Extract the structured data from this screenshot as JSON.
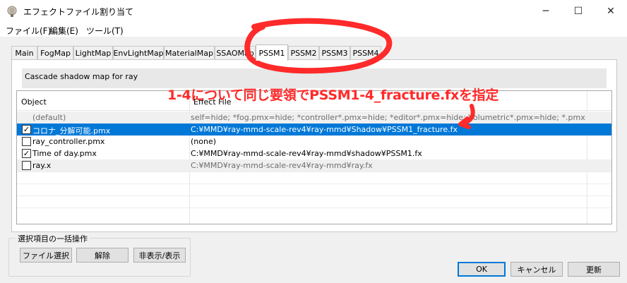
{
  "window": {
    "title": "エフェクトファイル割り当て",
    "minimize_glyph": "─",
    "maximize_glyph": "☐",
    "close_glyph": "✕"
  },
  "menu": [
    "ファイル(F)",
    "編集(E)",
    "ツール(T)"
  ],
  "tabs": [
    "Main",
    "FogMap",
    "LightMap",
    "EnvLightMap",
    "MaterialMap",
    "SSAOMap",
    "PSSM1",
    "PSSM2",
    "PSSM3",
    "PSSM4"
  ],
  "active_tab": "PSSM1",
  "description": "Cascade shadow map for ray",
  "list": {
    "columns": [
      "Object",
      "Effect File"
    ],
    "rows": [
      {
        "checkbox": false,
        "checked": false,
        "object": "(default)",
        "effect": "self=hide; *fog.pmx=hide; *controller*.pmx=hide; *editor*.pmx=hide; Volumetric*.pmx=hide; *.pmx=C:¥MM...",
        "state": "dim"
      },
      {
        "checkbox": true,
        "checked": true,
        "object": "コロナ_分解可能.pmx",
        "effect": "C:¥MMD¥ray-mmd-scale-rev4¥ray-mmd¥Shadow¥PSSM1_fracture.fx",
        "state": "selected"
      },
      {
        "checkbox": true,
        "checked": false,
        "object": "ray_controller.pmx",
        "effect": "(none)",
        "state": "normal"
      },
      {
        "checkbox": true,
        "checked": true,
        "object": "Time of day.pmx",
        "effect": "C:¥MMD¥ray-mmd-scale-rev4¥ray-mmd¥shadow¥PSSM1.fx",
        "state": "normal"
      },
      {
        "checkbox": true,
        "checked": false,
        "object": "ray.x",
        "effect": "C:¥MMD¥ray-mmd-scale-rev4¥ray-mmd¥ray.fx",
        "state": "dim"
      }
    ]
  },
  "batch": {
    "label": "選択項目の一括操作",
    "select_file": "ファイル選択",
    "release": "解除",
    "toggle_visibility": "非表示/表示"
  },
  "footer": {
    "ok": "OK",
    "cancel": "キャンセル",
    "refresh": "更新"
  },
  "annotation": {
    "text": "1-4について同じ要領でPSSM1-4_fracture.fxを指定",
    "color": "#ff2a2a"
  },
  "colors": {
    "selection": "#0078d7",
    "annotation": "#ff2a2a"
  }
}
